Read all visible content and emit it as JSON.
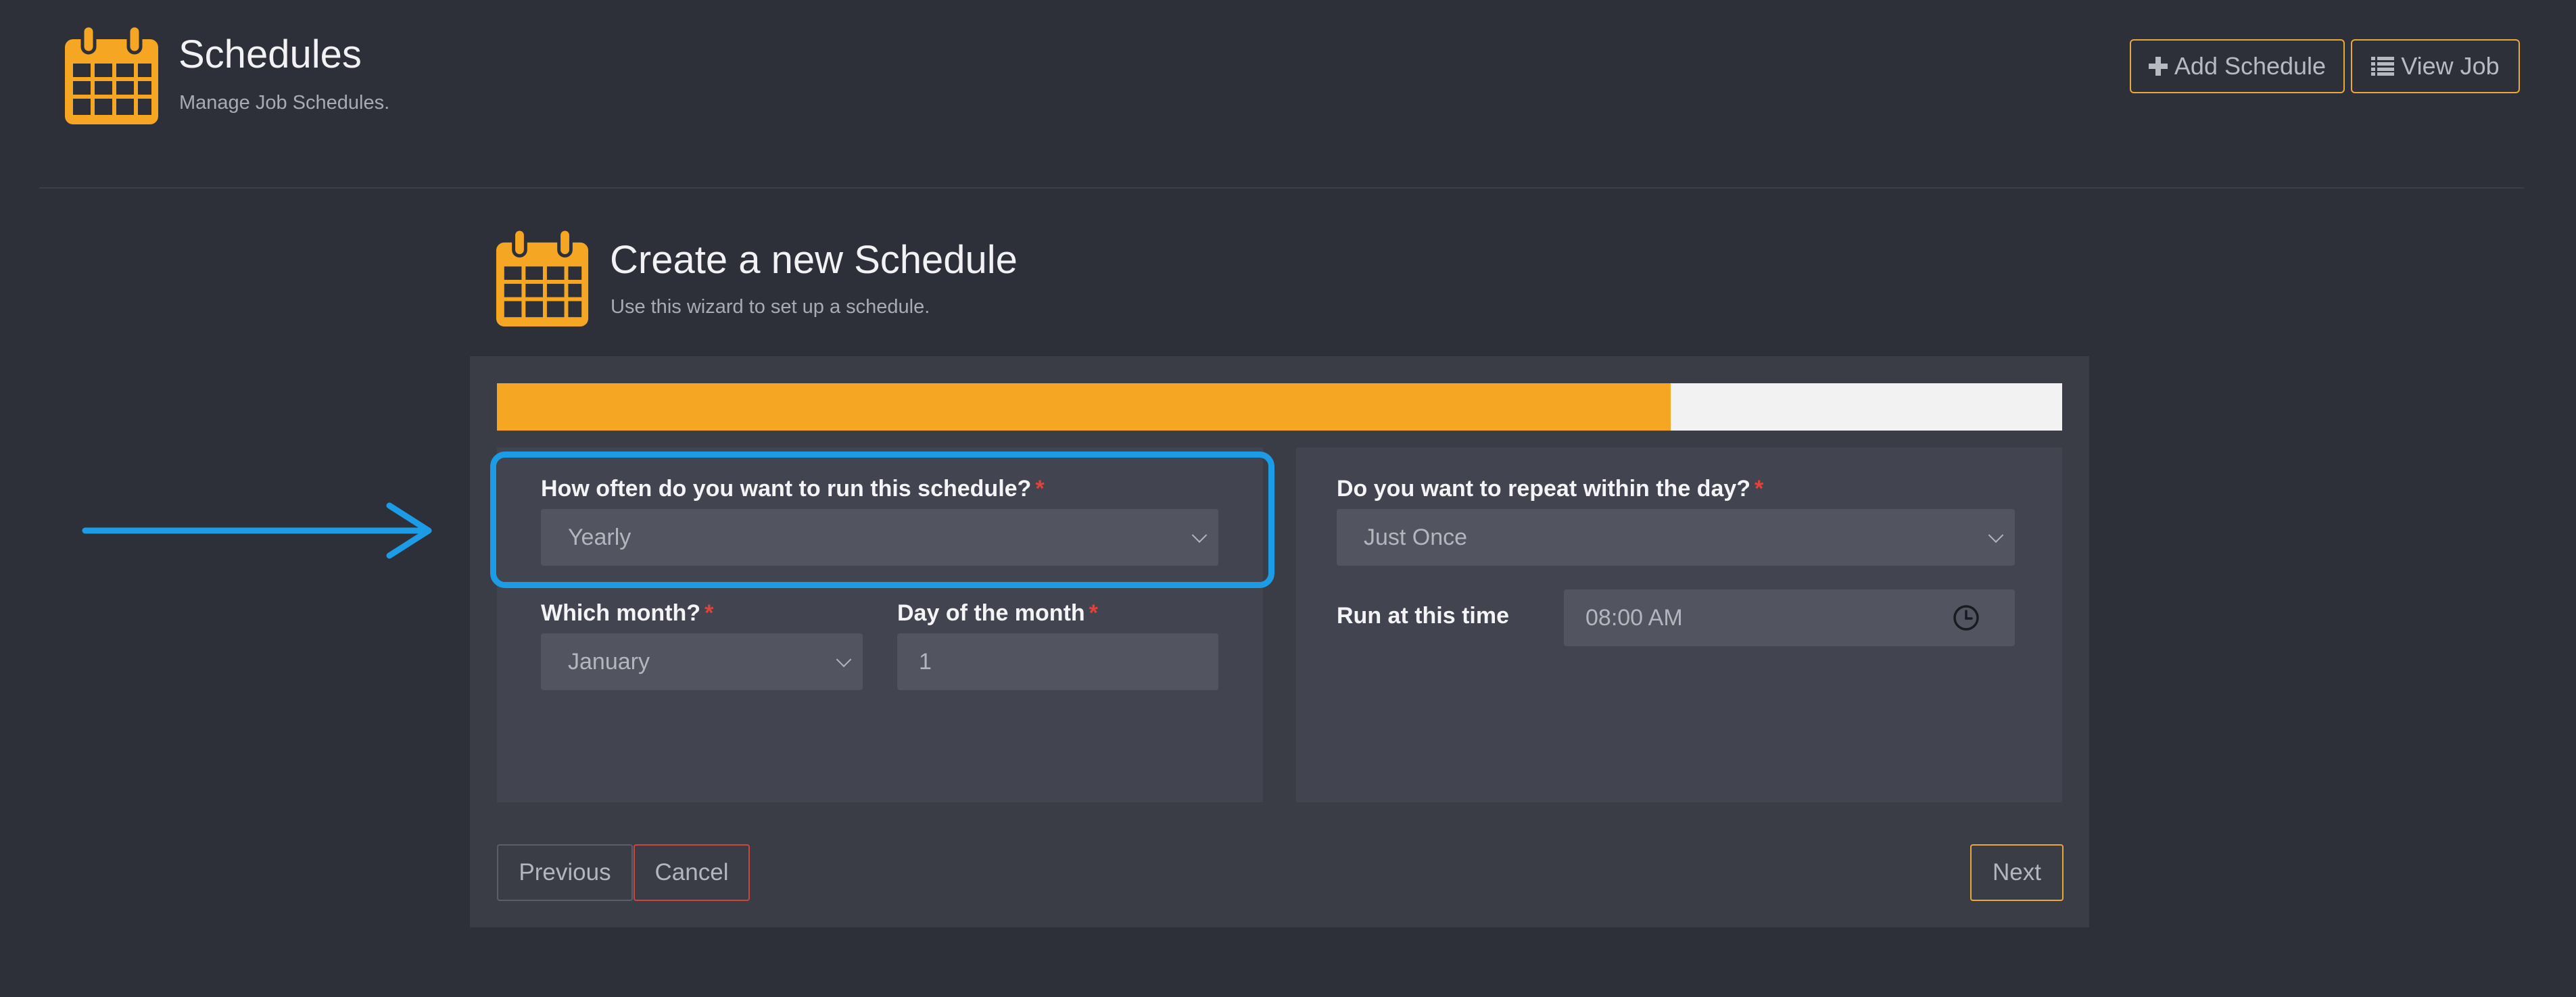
{
  "header": {
    "title": "Schedules",
    "subtitle": "Manage Job Schedules.",
    "add_schedule_label": "Add Schedule",
    "view_job_label": "View Job"
  },
  "wizard": {
    "title": "Create a new Schedule",
    "subtitle": "Use this wizard to set up a schedule.",
    "progress_percent": 75,
    "frequency": {
      "label": "How often do you want to run this schedule?",
      "required_marker": "*",
      "value": "Yearly"
    },
    "month": {
      "label": "Which month?",
      "required_marker": "*",
      "value": "January"
    },
    "day_of_month": {
      "label": "Day of the month",
      "required_marker": "*",
      "value": "1"
    },
    "repeat": {
      "label": "Do you want to repeat within the day?",
      "required_marker": "*",
      "value": "Just Once"
    },
    "run_time": {
      "label": "Run at this time",
      "value": "08:00 AM"
    },
    "buttons": {
      "previous": "Previous",
      "cancel": "Cancel",
      "next": "Next"
    }
  },
  "colors": {
    "accent": "#f5a623",
    "highlight": "#1c9ce6",
    "danger": "#e0433c",
    "background": "#2e3039"
  },
  "icons": {
    "header": "calendar-icon",
    "wizard": "calendar-icon",
    "add": "plus-icon",
    "view": "list-icon",
    "time": "clock-icon"
  }
}
